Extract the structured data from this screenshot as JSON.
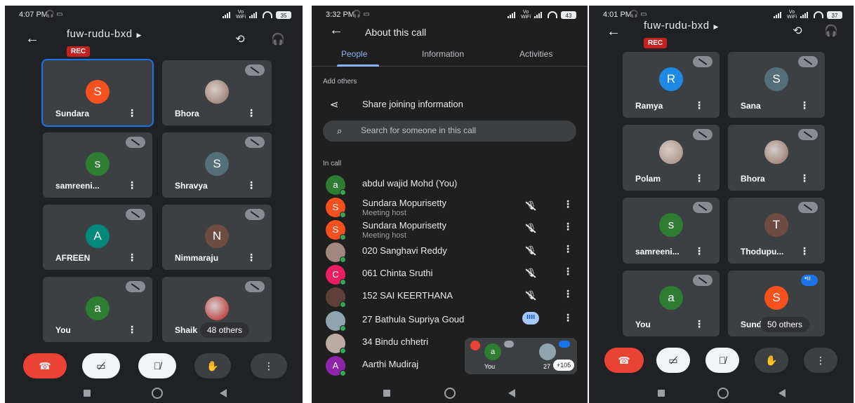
{
  "left_phone": {
    "status": {
      "time": "4:07 PM",
      "battery": "35"
    },
    "meeting_code": "fuw-rudu-bxd",
    "rec_label": "REC",
    "tiles": [
      {
        "name": "Sundara",
        "initial": "S",
        "color": "#f4511e",
        "active": true,
        "muted": false,
        "photo": false
      },
      {
        "name": "Bhora",
        "initial": "",
        "color": "#8d6e63",
        "active": false,
        "muted": true,
        "photo": true
      },
      {
        "name": "samreeni...",
        "initial": "s",
        "color": "#2e7d32",
        "active": false,
        "muted": true,
        "photo": false
      },
      {
        "name": "Shravya",
        "initial": "S",
        "color": "#546e7a",
        "active": false,
        "muted": true,
        "photo": false
      },
      {
        "name": "AFREEN",
        "initial": "A",
        "color": "#00897b",
        "active": false,
        "muted": true,
        "photo": false
      },
      {
        "name": "Nimmaraju",
        "initial": "N",
        "color": "#6d4c41",
        "active": false,
        "muted": true,
        "photo": false
      },
      {
        "name": "You",
        "initial": "a",
        "color": "#2e7d32",
        "active": false,
        "muted": true,
        "photo": false
      },
      {
        "name": "Shaik",
        "initial": "",
        "color": "#b71c1c",
        "active": false,
        "muted": true,
        "photo": true
      }
    ],
    "others": "48 others"
  },
  "middle_phone": {
    "status": {
      "time": "3:32 PM",
      "battery": "43"
    },
    "title": "About this call",
    "tabs": [
      "People",
      "Information",
      "Activities"
    ],
    "add_others_label": "Add others",
    "share_label": "Share joining information",
    "search_placeholder": "Search for someone in this call",
    "in_call_label": "In call",
    "participants": [
      {
        "name": "abdul wajid Mohd (You)",
        "sub": "",
        "initial": "a",
        "color": "#2e7d32",
        "state": "none"
      },
      {
        "name": "Sundara Mopurisetty",
        "sub": "Meeting host",
        "initial": "S",
        "color": "#f4511e",
        "state": "muted"
      },
      {
        "name": "Sundara Mopurisetty",
        "sub": "Meeting host",
        "initial": "S",
        "color": "#f4511e",
        "state": "muted"
      },
      {
        "name": "020 Sanghavi Reddy",
        "sub": "",
        "initial": "",
        "color": "#a1887f",
        "state": "muted"
      },
      {
        "name": "061 Chinta Sruthi",
        "sub": "",
        "initial": "C",
        "color": "#e91e63",
        "state": "muted"
      },
      {
        "name": "152 SAI KEERTHANA",
        "sub": "",
        "initial": "",
        "color": "#5d4037",
        "state": "muted"
      },
      {
        "name": "27 Bathula Supriya Goud",
        "sub": "",
        "initial": "",
        "color": "#90a4ae",
        "state": "speaking"
      },
      {
        "name": "34 Bindu chhetri",
        "sub": "",
        "initial": "",
        "color": "#bcaaa4",
        "state": "none"
      },
      {
        "name": "Aarthi Mudiraj",
        "sub": "",
        "initial": "A",
        "color": "#8e24aa",
        "state": "none"
      }
    ],
    "mini": {
      "you_label": "You",
      "other_label": "27",
      "plus_label": "+105"
    }
  },
  "right_phone": {
    "status": {
      "time": "4:01 PM",
      "battery": "37"
    },
    "meeting_code": "fuw-rudu-bxd",
    "rec_label": "REC",
    "tiles": [
      {
        "name": "Ramya",
        "initial": "R",
        "color": "#1e88e5",
        "muted": true,
        "photo": false,
        "speaking": false
      },
      {
        "name": "Sana",
        "initial": "S",
        "color": "#546e7a",
        "muted": true,
        "photo": false,
        "speaking": false
      },
      {
        "name": "Polam",
        "initial": "",
        "color": "#a1887f",
        "muted": true,
        "photo": true,
        "speaking": false
      },
      {
        "name": "Bhora",
        "initial": "",
        "color": "#8d6e63",
        "muted": true,
        "photo": true,
        "speaking": false
      },
      {
        "name": "samreeni...",
        "initial": "s",
        "color": "#2e7d32",
        "muted": true,
        "photo": false,
        "speaking": false
      },
      {
        "name": "Thodupu...",
        "initial": "T",
        "color": "#6d4c41",
        "muted": true,
        "photo": false,
        "speaking": false
      },
      {
        "name": "You",
        "initial": "a",
        "color": "#2e7d32",
        "muted": true,
        "photo": false,
        "speaking": false
      },
      {
        "name": "Sund",
        "initial": "S",
        "color": "#f4511e",
        "muted": false,
        "photo": false,
        "speaking": true
      }
    ],
    "others": "50 others"
  }
}
